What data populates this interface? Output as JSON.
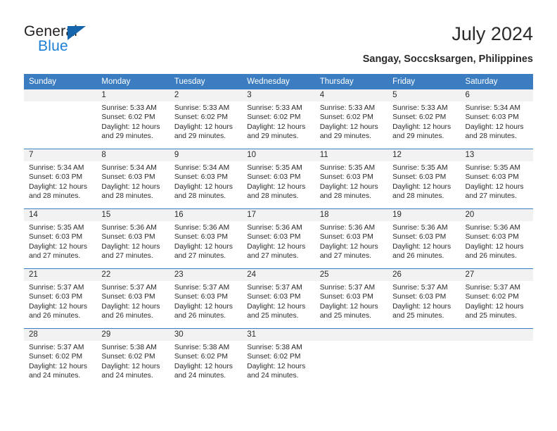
{
  "brand": {
    "name_part1": "General",
    "name_part2": "Blue",
    "triangle_icon": "triangle-icon",
    "accent_color": "#1b7fd4",
    "header_color": "#3b7dc0"
  },
  "header": {
    "title": "July 2024",
    "location": "Sangay, Soccsksargen, Philippines"
  },
  "calendar": {
    "weekday_headers": [
      "Sunday",
      "Monday",
      "Tuesday",
      "Wednesday",
      "Thursday",
      "Friday",
      "Saturday"
    ],
    "weeks": [
      [
        {
          "day": "",
          "sunrise": "",
          "sunset": "",
          "daylight_line1": "",
          "daylight_line2": ""
        },
        {
          "day": "1",
          "sunrise": "Sunrise: 5:33 AM",
          "sunset": "Sunset: 6:02 PM",
          "daylight_line1": "Daylight: 12 hours",
          "daylight_line2": "and 29 minutes."
        },
        {
          "day": "2",
          "sunrise": "Sunrise: 5:33 AM",
          "sunset": "Sunset: 6:02 PM",
          "daylight_line1": "Daylight: 12 hours",
          "daylight_line2": "and 29 minutes."
        },
        {
          "day": "3",
          "sunrise": "Sunrise: 5:33 AM",
          "sunset": "Sunset: 6:02 PM",
          "daylight_line1": "Daylight: 12 hours",
          "daylight_line2": "and 29 minutes."
        },
        {
          "day": "4",
          "sunrise": "Sunrise: 5:33 AM",
          "sunset": "Sunset: 6:02 PM",
          "daylight_line1": "Daylight: 12 hours",
          "daylight_line2": "and 29 minutes."
        },
        {
          "day": "5",
          "sunrise": "Sunrise: 5:33 AM",
          "sunset": "Sunset: 6:02 PM",
          "daylight_line1": "Daylight: 12 hours",
          "daylight_line2": "and 29 minutes."
        },
        {
          "day": "6",
          "sunrise": "Sunrise: 5:34 AM",
          "sunset": "Sunset: 6:03 PM",
          "daylight_line1": "Daylight: 12 hours",
          "daylight_line2": "and 28 minutes."
        }
      ],
      [
        {
          "day": "7",
          "sunrise": "Sunrise: 5:34 AM",
          "sunset": "Sunset: 6:03 PM",
          "daylight_line1": "Daylight: 12 hours",
          "daylight_line2": "and 28 minutes."
        },
        {
          "day": "8",
          "sunrise": "Sunrise: 5:34 AM",
          "sunset": "Sunset: 6:03 PM",
          "daylight_line1": "Daylight: 12 hours",
          "daylight_line2": "and 28 minutes."
        },
        {
          "day": "9",
          "sunrise": "Sunrise: 5:34 AM",
          "sunset": "Sunset: 6:03 PM",
          "daylight_line1": "Daylight: 12 hours",
          "daylight_line2": "and 28 minutes."
        },
        {
          "day": "10",
          "sunrise": "Sunrise: 5:35 AM",
          "sunset": "Sunset: 6:03 PM",
          "daylight_line1": "Daylight: 12 hours",
          "daylight_line2": "and 28 minutes."
        },
        {
          "day": "11",
          "sunrise": "Sunrise: 5:35 AM",
          "sunset": "Sunset: 6:03 PM",
          "daylight_line1": "Daylight: 12 hours",
          "daylight_line2": "and 28 minutes."
        },
        {
          "day": "12",
          "sunrise": "Sunrise: 5:35 AM",
          "sunset": "Sunset: 6:03 PM",
          "daylight_line1": "Daylight: 12 hours",
          "daylight_line2": "and 28 minutes."
        },
        {
          "day": "13",
          "sunrise": "Sunrise: 5:35 AM",
          "sunset": "Sunset: 6:03 PM",
          "daylight_line1": "Daylight: 12 hours",
          "daylight_line2": "and 27 minutes."
        }
      ],
      [
        {
          "day": "14",
          "sunrise": "Sunrise: 5:35 AM",
          "sunset": "Sunset: 6:03 PM",
          "daylight_line1": "Daylight: 12 hours",
          "daylight_line2": "and 27 minutes."
        },
        {
          "day": "15",
          "sunrise": "Sunrise: 5:36 AM",
          "sunset": "Sunset: 6:03 PM",
          "daylight_line1": "Daylight: 12 hours",
          "daylight_line2": "and 27 minutes."
        },
        {
          "day": "16",
          "sunrise": "Sunrise: 5:36 AM",
          "sunset": "Sunset: 6:03 PM",
          "daylight_line1": "Daylight: 12 hours",
          "daylight_line2": "and 27 minutes."
        },
        {
          "day": "17",
          "sunrise": "Sunrise: 5:36 AM",
          "sunset": "Sunset: 6:03 PM",
          "daylight_line1": "Daylight: 12 hours",
          "daylight_line2": "and 27 minutes."
        },
        {
          "day": "18",
          "sunrise": "Sunrise: 5:36 AM",
          "sunset": "Sunset: 6:03 PM",
          "daylight_line1": "Daylight: 12 hours",
          "daylight_line2": "and 27 minutes."
        },
        {
          "day": "19",
          "sunrise": "Sunrise: 5:36 AM",
          "sunset": "Sunset: 6:03 PM",
          "daylight_line1": "Daylight: 12 hours",
          "daylight_line2": "and 26 minutes."
        },
        {
          "day": "20",
          "sunrise": "Sunrise: 5:36 AM",
          "sunset": "Sunset: 6:03 PM",
          "daylight_line1": "Daylight: 12 hours",
          "daylight_line2": "and 26 minutes."
        }
      ],
      [
        {
          "day": "21",
          "sunrise": "Sunrise: 5:37 AM",
          "sunset": "Sunset: 6:03 PM",
          "daylight_line1": "Daylight: 12 hours",
          "daylight_line2": "and 26 minutes."
        },
        {
          "day": "22",
          "sunrise": "Sunrise: 5:37 AM",
          "sunset": "Sunset: 6:03 PM",
          "daylight_line1": "Daylight: 12 hours",
          "daylight_line2": "and 26 minutes."
        },
        {
          "day": "23",
          "sunrise": "Sunrise: 5:37 AM",
          "sunset": "Sunset: 6:03 PM",
          "daylight_line1": "Daylight: 12 hours",
          "daylight_line2": "and 26 minutes."
        },
        {
          "day": "24",
          "sunrise": "Sunrise: 5:37 AM",
          "sunset": "Sunset: 6:03 PM",
          "daylight_line1": "Daylight: 12 hours",
          "daylight_line2": "and 25 minutes."
        },
        {
          "day": "25",
          "sunrise": "Sunrise: 5:37 AM",
          "sunset": "Sunset: 6:03 PM",
          "daylight_line1": "Daylight: 12 hours",
          "daylight_line2": "and 25 minutes."
        },
        {
          "day": "26",
          "sunrise": "Sunrise: 5:37 AM",
          "sunset": "Sunset: 6:03 PM",
          "daylight_line1": "Daylight: 12 hours",
          "daylight_line2": "and 25 minutes."
        },
        {
          "day": "27",
          "sunrise": "Sunrise: 5:37 AM",
          "sunset": "Sunset: 6:02 PM",
          "daylight_line1": "Daylight: 12 hours",
          "daylight_line2": "and 25 minutes."
        }
      ],
      [
        {
          "day": "28",
          "sunrise": "Sunrise: 5:37 AM",
          "sunset": "Sunset: 6:02 PM",
          "daylight_line1": "Daylight: 12 hours",
          "daylight_line2": "and 24 minutes."
        },
        {
          "day": "29",
          "sunrise": "Sunrise: 5:38 AM",
          "sunset": "Sunset: 6:02 PM",
          "daylight_line1": "Daylight: 12 hours",
          "daylight_line2": "and 24 minutes."
        },
        {
          "day": "30",
          "sunrise": "Sunrise: 5:38 AM",
          "sunset": "Sunset: 6:02 PM",
          "daylight_line1": "Daylight: 12 hours",
          "daylight_line2": "and 24 minutes."
        },
        {
          "day": "31",
          "sunrise": "Sunrise: 5:38 AM",
          "sunset": "Sunset: 6:02 PM",
          "daylight_line1": "Daylight: 12 hours",
          "daylight_line2": "and 24 minutes."
        },
        {
          "day": "",
          "sunrise": "",
          "sunset": "",
          "daylight_line1": "",
          "daylight_line2": ""
        },
        {
          "day": "",
          "sunrise": "",
          "sunset": "",
          "daylight_line1": "",
          "daylight_line2": ""
        },
        {
          "day": "",
          "sunrise": "",
          "sunset": "",
          "daylight_line1": "",
          "daylight_line2": ""
        }
      ]
    ]
  }
}
